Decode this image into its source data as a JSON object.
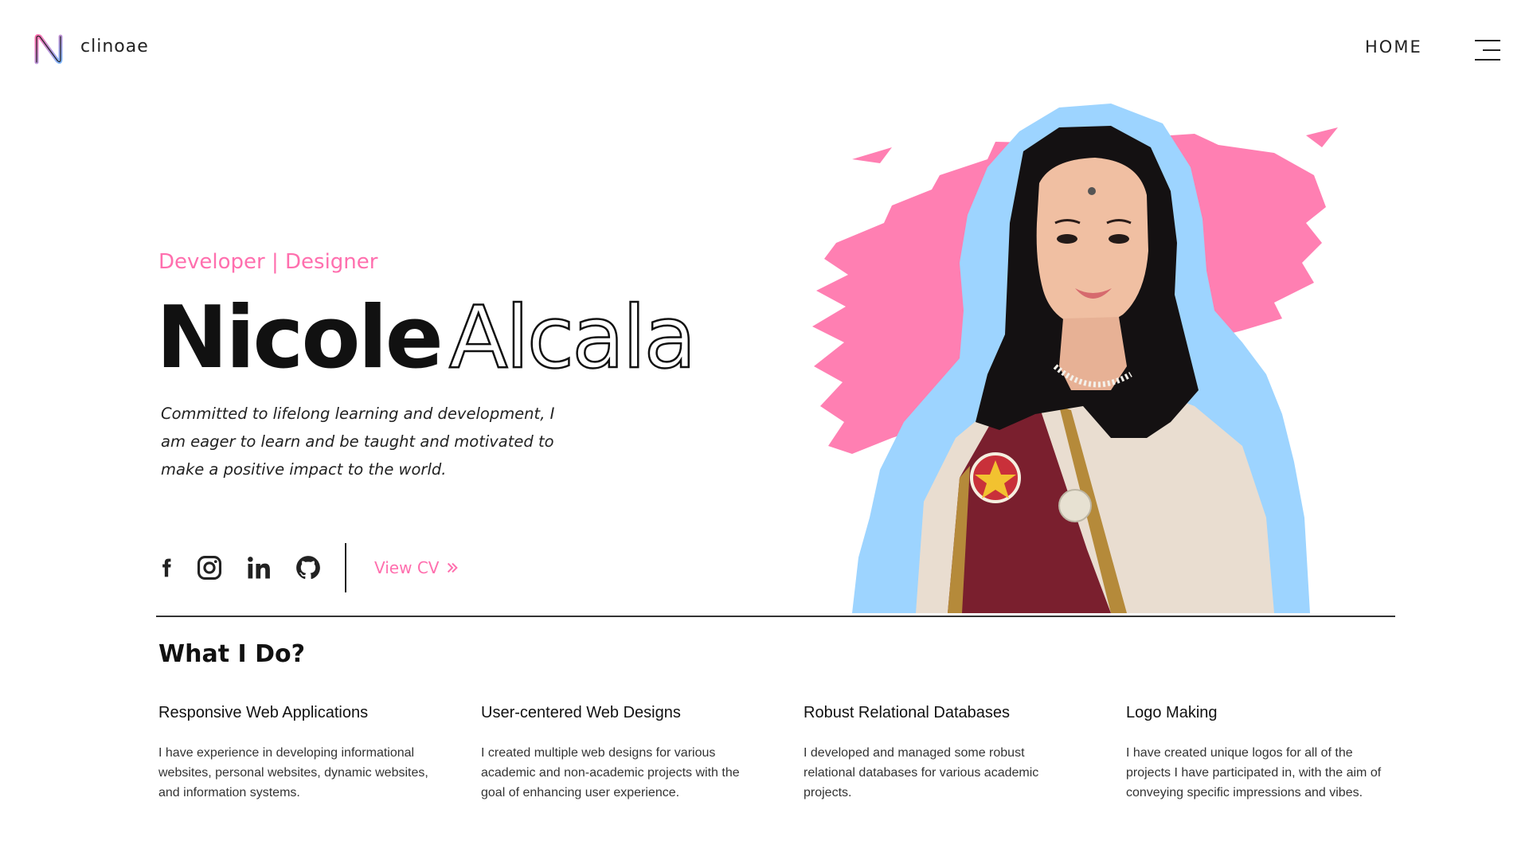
{
  "header": {
    "brand": "clinoae",
    "nav_home": "HOME",
    "logo_icon": "n-letter-logo",
    "menu_icon": "hamburger-menu-icon"
  },
  "hero": {
    "tagline": "Developer | Designer",
    "first_name": "Nicole",
    "last_name": "Alcala",
    "bio": "Committed to lifelong learning and development, I am eager to learn and be taught and motivated to make a positive impact to the world.",
    "socials": [
      "facebook-icon",
      "instagram-icon",
      "linkedin-icon",
      "github-icon"
    ],
    "view_cv": "View CV"
  },
  "what_i_do": {
    "title": "What I Do?",
    "items": [
      {
        "title": "Responsive Web Applications",
        "desc": "I have experience in developing informational websites, personal websites, dynamic websites, and information systems."
      },
      {
        "title": "User-centered Web Designs",
        "desc": "I created multiple web designs for various academic and non-academic projects with the goal of enhancing user experience."
      },
      {
        "title": "Robust Relational Databases",
        "desc": "I developed and managed some robust relational databases for various academic projects."
      },
      {
        "title": "Logo Making",
        "desc": "I have created unique logos for all of the projects I have participated in, with the aim of conveying specific impressions and vibes."
      }
    ]
  },
  "colors": {
    "accent_pink": "#ff6fae",
    "accent_blue": "#9dd4ff",
    "text_dark": "#111111"
  }
}
